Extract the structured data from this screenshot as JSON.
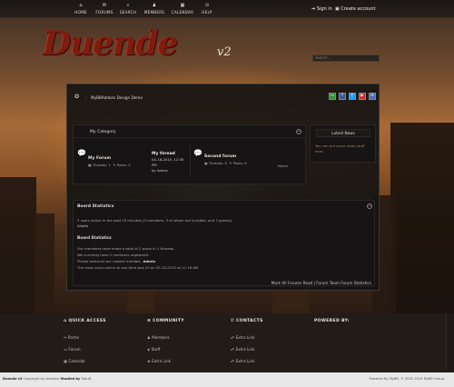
{
  "nav": {
    "items": [
      {
        "label": "HOME",
        "icon": "home-icon",
        "glyph": "⌂"
      },
      {
        "label": "FORUMS",
        "icon": "comments-icon",
        "glyph": "✉"
      },
      {
        "label": "SEARCH",
        "icon": "search-icon",
        "glyph": "⌕"
      },
      {
        "label": "MEMBERS",
        "icon": "user-icon",
        "glyph": "♟"
      },
      {
        "label": "CALENDAR",
        "icon": "calendar-icon",
        "glyph": "▦"
      },
      {
        "label": "HELP",
        "icon": "help-icon",
        "glyph": "⊙"
      }
    ],
    "signin": "Sign in",
    "create_account": "Create account"
  },
  "logo": {
    "text": "Duende",
    "version": "v2"
  },
  "search": {
    "placeholder": "Search..."
  },
  "breadcrumb": {
    "home_glyph": "✪",
    "current": "MyBBAddons Design Demo"
  },
  "social": [
    {
      "icon": "monitor-icon",
      "glyph": "▭",
      "color": "#2f8f3a"
    },
    {
      "icon": "facebook-icon",
      "glyph": "f",
      "color": "#3b5998"
    },
    {
      "icon": "twitter-icon",
      "glyph": "t",
      "color": "#1da1f2"
    },
    {
      "icon": "youtube-icon",
      "glyph": "▶",
      "color": "#c4302b"
    },
    {
      "icon": "rss-icon",
      "glyph": "≡",
      "color": "#4a6fb0"
    }
  ],
  "category": {
    "title": "My Category",
    "collapse_glyph": "−",
    "forums": [
      {
        "name": "My Forum",
        "threads": "Threads: 1",
        "posts": "Posts: 2",
        "lastpost_title": "My thread",
        "lastpost_date": "04-18-2015, 12:05",
        "lastpost_ampm": "PM",
        "lastpost_by": "by Admin"
      },
      {
        "name": "Second forum",
        "threads": "Threads: 0",
        "posts": "Posts: 0",
        "lastpost": "Never"
      }
    ]
  },
  "latest_news": {
    "title": "Latest News",
    "body": "You can put some news stuff here"
  },
  "board_stats": {
    "title": "Board Statistics",
    "collapse_glyph": "−",
    "online_line": "3 users active in the past 15 minutes (0 members, 3 of whom are invisible, and 3 guests).",
    "online_names": "Adolfo",
    "sub_title": "Board Statistics",
    "line1": "Our members have made a total of 2 posts in 1 threads.",
    "line2": "We currently have 1 members registered.",
    "line3_prefix": "Please welcome our newest member, ",
    "line3_name": "Admin",
    "line4": "The most users online at one time was 20 on 05-10-2015 at 11:16 AM",
    "links": "Mark All Forums Read | Forum Team  Forum Statistics"
  },
  "footer": {
    "quick_access": {
      "title": "QUICK ACCESS",
      "icon": "home-icon",
      "links": [
        {
          "label": "Portal",
          "icon": "link-icon",
          "glyph": "↪"
        },
        {
          "label": "Forum",
          "icon": "forum-icon",
          "glyph": "▭"
        },
        {
          "label": "Calendar",
          "icon": "calendar-icon",
          "glyph": "▦"
        }
      ]
    },
    "community": {
      "title": "COMMUNITY",
      "icon": "list-icon",
      "links": [
        {
          "label": "Members",
          "icon": "users-icon",
          "glyph": "♟"
        },
        {
          "label": "Staff",
          "icon": "shield-icon",
          "glyph": "◈"
        },
        {
          "label": "Extra Link",
          "icon": "star-icon",
          "glyph": "★"
        }
      ]
    },
    "contacts": {
      "title": "CONTACTS",
      "icon": "phone-icon",
      "links": [
        {
          "label": "Extra Link",
          "icon": "link-icon",
          "glyph": "☍"
        },
        {
          "label": "Extra Link",
          "icon": "link-icon",
          "glyph": "☍"
        },
        {
          "label": "Extra Link",
          "icon": "link-icon",
          "glyph": "☍"
        }
      ]
    },
    "powered": {
      "title": "POWERED BY:"
    }
  },
  "bottom": {
    "theme_name": "Duende v2",
    "credit_text": "Copyright by shadrew",
    "studied_label": "Studied by",
    "studied_name": "Stauft",
    "powered_text": "Powered By MyBB, © 2002-2015 MyBB Group."
  }
}
